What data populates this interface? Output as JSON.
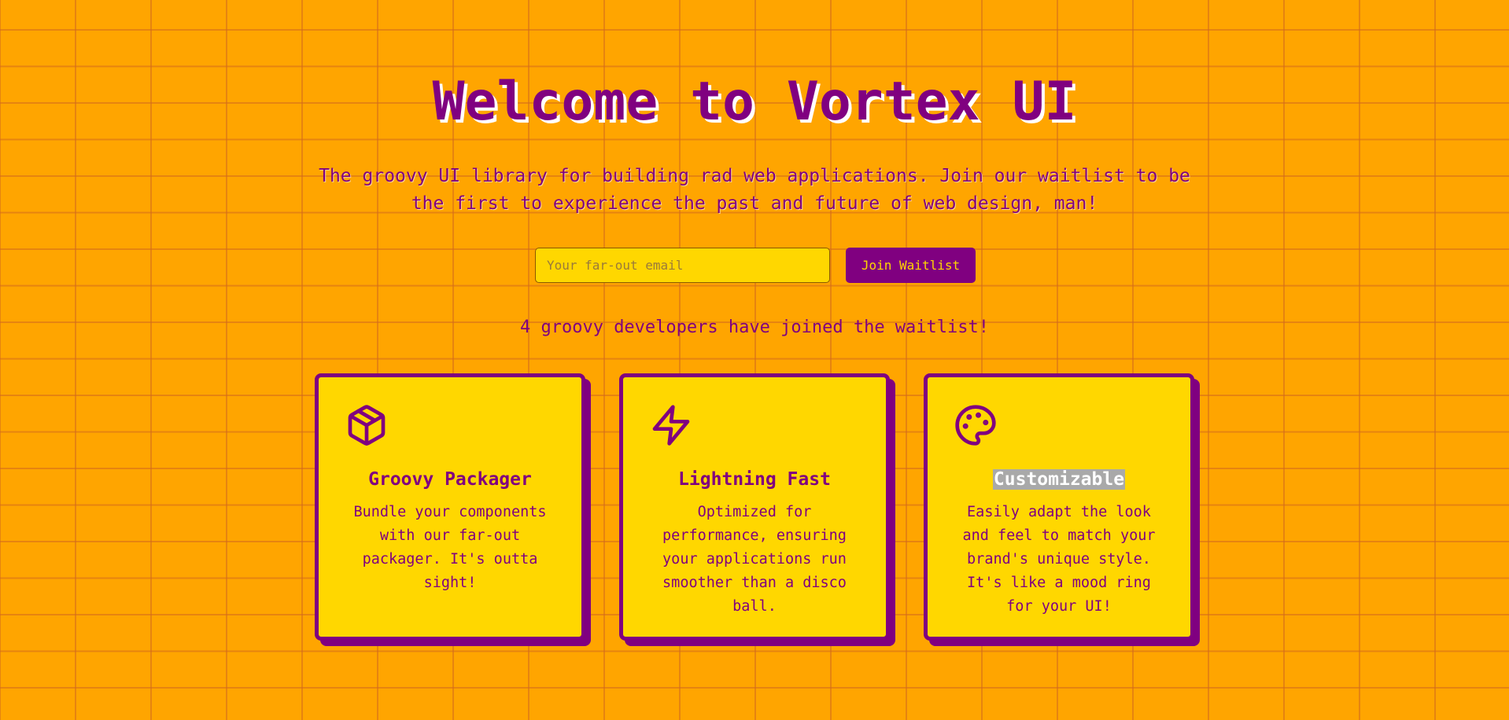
{
  "hero": {
    "title": "Welcome to Vortex UI",
    "subtitle": "The groovy UI library for building rad web applications. Join our waitlist to be the first to experience the past and future of web design, man!"
  },
  "signup": {
    "email_placeholder": "Your far-out email",
    "email_value": "",
    "join_label": "Join Waitlist",
    "waitlist_text": "4 groovy developers have joined the waitlist!"
  },
  "features": [
    {
      "icon": "package-icon",
      "title": "Groovy Packager",
      "description": "Bundle your components with our far-out packager. It's outta sight!"
    },
    {
      "icon": "lightning-icon",
      "title": "Lightning Fast",
      "description": "Optimized for performance, ensuring your applications run smoother than a disco ball."
    },
    {
      "icon": "palette-icon",
      "title": "Customizable",
      "description": "Easily adapt the look and feel to match your brand's unique style. It's like a mood ring for your UI!"
    }
  ],
  "colors": {
    "background": "#FFA500",
    "grid_line": "#D2691E",
    "primary": "#800080",
    "card_background": "#FFD700",
    "title_shadow": "#FFFFFF",
    "selection_highlight": "#A9A9A9"
  }
}
